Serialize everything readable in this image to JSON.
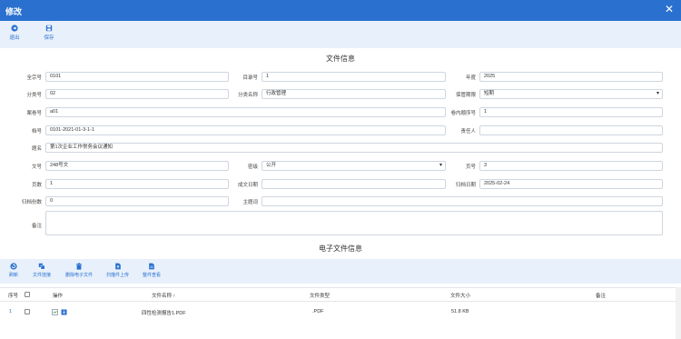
{
  "window": {
    "title": "修改",
    "close_glyph": "✕"
  },
  "toolbar": {
    "exit_label": "退出",
    "save_label": "保存"
  },
  "file_info": {
    "section_title": "文件信息",
    "fields": {
      "quanzonghao": {
        "label": "全宗号",
        "value": "0101"
      },
      "muluhao": {
        "label": "目录号",
        "value": "1"
      },
      "niandu": {
        "label": "年度",
        "value": "2025"
      },
      "fenleihao": {
        "label": "分类号",
        "value": "02"
      },
      "fenleimingcheng": {
        "label": "分类名称",
        "value": "行政管理"
      },
      "baoguanqixian": {
        "label": "保管期限",
        "value": "短期"
      },
      "anjuanhao": {
        "label": "案卷号",
        "value": "a01"
      },
      "juanneishunxuhao": {
        "label": "卷内顺序号",
        "value": "1"
      },
      "danghao": {
        "label": "档号",
        "value": "0101-2021-01-3-1-1"
      },
      "zerenren": {
        "label": "责任人",
        "value": ""
      },
      "timing": {
        "label": "题名",
        "value": "第1次企业工作常务会议通知"
      },
      "wenhao": {
        "label": "文号",
        "value": "248号文"
      },
      "miji": {
        "label": "密级",
        "value": "公开"
      },
      "yehao": {
        "label": "页号",
        "value": "3"
      },
      "yeshu": {
        "label": "页数",
        "value": "1"
      },
      "chengwenriqi": {
        "label": "成文日期",
        "value": ""
      },
      "guidangriqi": {
        "label": "归档日期",
        "value": "2025-02-24"
      },
      "guidangfenshu": {
        "label": "归档份数",
        "value": "0"
      },
      "zhutici": {
        "label": "主题词",
        "value": ""
      },
      "beizhu": {
        "label": "备注",
        "value": ""
      }
    }
  },
  "electronic": {
    "section_title": "电子文件信息",
    "toolbar": {
      "refresh": "刷新",
      "attach": "文件挂接",
      "delete": "删除电子文件",
      "scan_upload": "扫描件上传",
      "view_all": "整件查看"
    },
    "columns": {
      "index": "序号",
      "action": "操作",
      "name": "文件名称 ↑",
      "type": "文件类型",
      "size": "文件大小",
      "note": "备注"
    },
    "rows": [
      {
        "index": "1",
        "name": "四性检测报告1.PDF",
        "type": ".PDF",
        "size": "51.8 KB",
        "note": ""
      }
    ]
  },
  "colors": {
    "accent": "#2a71cf",
    "toolbar_bg": "#e8f0fb"
  }
}
